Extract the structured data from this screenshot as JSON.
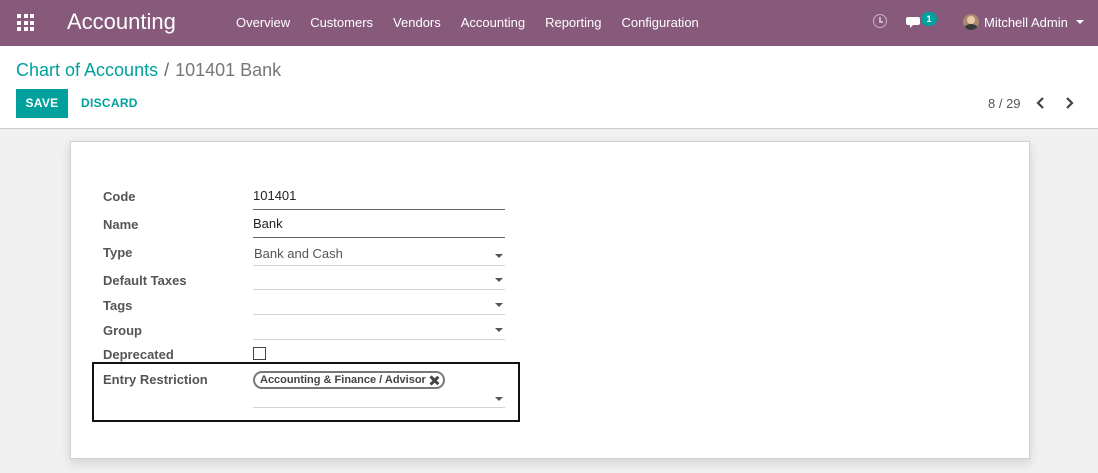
{
  "navbar": {
    "brand": "Accounting",
    "menu": [
      "Overview",
      "Customers",
      "Vendors",
      "Accounting",
      "Reporting",
      "Configuration"
    ],
    "chat_count": "1",
    "user": "Mitchell Admin"
  },
  "breadcrumb": {
    "parent": "Chart of Accounts",
    "separator": "/",
    "current": "101401 Bank"
  },
  "actions": {
    "save": "SAVE",
    "discard": "DISCARD"
  },
  "pager": {
    "text": "8 / 29"
  },
  "form": {
    "code": {
      "label": "Code",
      "value": "101401"
    },
    "name": {
      "label": "Name",
      "value": "Bank"
    },
    "type": {
      "label": "Type",
      "value": "Bank and Cash"
    },
    "default_taxes": {
      "label": "Default Taxes",
      "value": ""
    },
    "tags": {
      "label": "Tags",
      "value": ""
    },
    "group": {
      "label": "Group",
      "value": ""
    },
    "deprecated": {
      "label": "Deprecated",
      "checked": false
    },
    "entry_restriction": {
      "label": "Entry Restriction",
      "tags": [
        "Accounting & Finance / Advisor"
      ]
    }
  },
  "colors": {
    "navbar": "#875a7b",
    "accent": "#00a09d"
  }
}
